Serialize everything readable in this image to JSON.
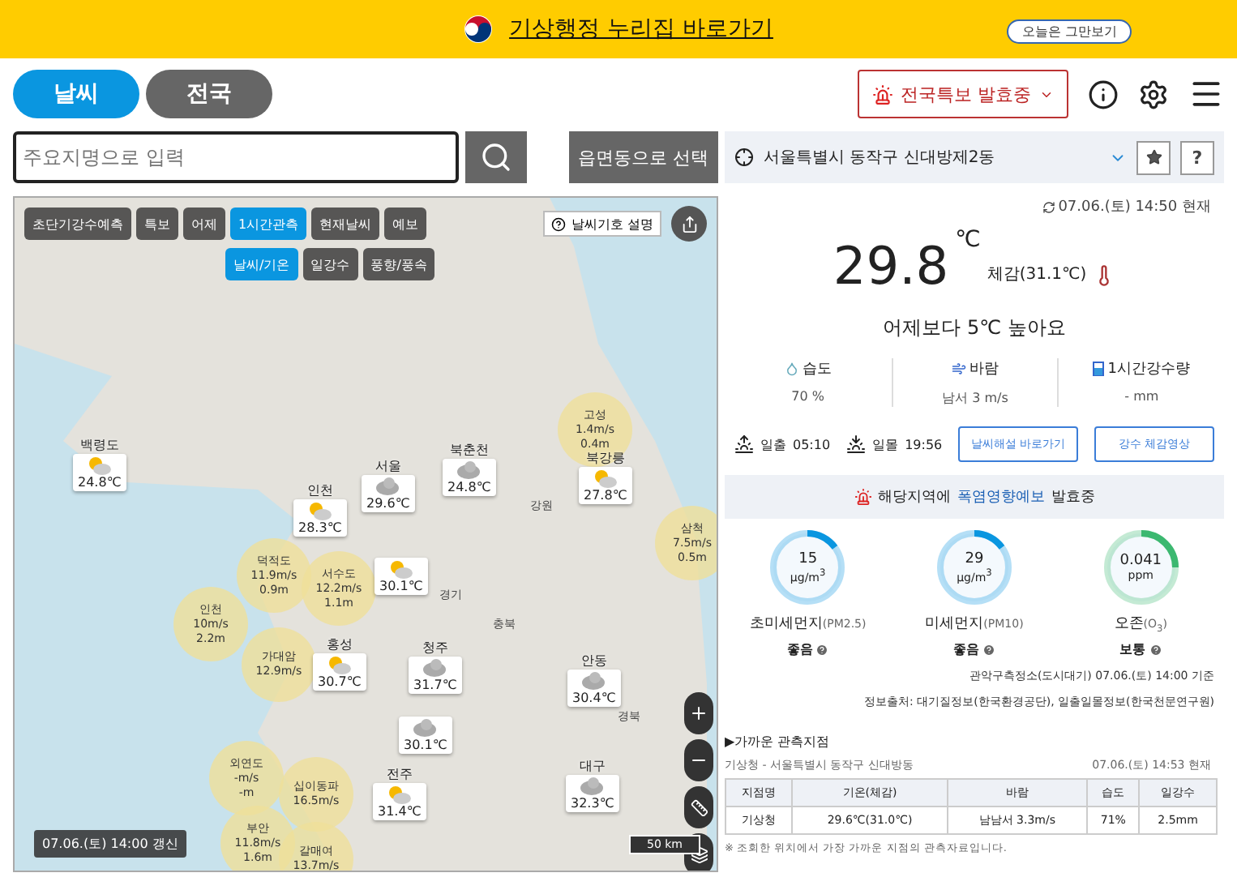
{
  "banner": {
    "link": "기상행정 누리집 바로가기",
    "dismiss": "오늘은 그만보기"
  },
  "tabs": [
    {
      "label": "날씨",
      "selected": true
    },
    {
      "label": "전국",
      "selected": false
    }
  ],
  "alert_dropdown": "전국특보 발효중",
  "search": {
    "placeholder": "주요지명으로 입력",
    "region_button": "읍면동으로 선택"
  },
  "map": {
    "tabs": [
      {
        "label": "초단기강수예측",
        "selected": false
      },
      {
        "label": "특보",
        "selected": false
      },
      {
        "label": "어제",
        "selected": false
      },
      {
        "label": "1시간관측",
        "selected": true
      },
      {
        "label": "현재날씨",
        "selected": false
      },
      {
        "label": "예보",
        "selected": false
      }
    ],
    "subtabs": [
      {
        "label": "날씨/기온",
        "selected": true
      },
      {
        "label": "일강수",
        "selected": false
      },
      {
        "label": "풍향/풍속",
        "selected": false
      }
    ],
    "legend_button": "날씨기호 설명",
    "regions": [
      "강원",
      "경기",
      "충북",
      "경북"
    ],
    "stations": [
      {
        "name": "백령도",
        "temp": "24.8℃",
        "kind": "sun_cloud"
      },
      {
        "name": "북춘천",
        "temp": "24.8℃",
        "kind": "cloud"
      },
      {
        "name": "북강릉",
        "temp": "27.8℃",
        "kind": "sun_cloud"
      },
      {
        "name": "서울",
        "temp": "29.6℃",
        "kind": "cloud"
      },
      {
        "name": "인천",
        "temp": "28.3℃",
        "kind": "sun_cloud"
      },
      {
        "temp": "30.1℃",
        "kind": "sun_cloud"
      },
      {
        "name": "홍성",
        "temp": "30.7℃",
        "kind": "sun_cloud"
      },
      {
        "name": "청주",
        "temp": "31.7℃",
        "kind": "cloud"
      },
      {
        "temp": "30.1℃",
        "kind": "cloud"
      },
      {
        "name": "안동",
        "temp": "30.4℃",
        "kind": "cloud"
      },
      {
        "name": "전주",
        "temp": "31.4℃",
        "kind": "sun_cloud"
      },
      {
        "name": "대구",
        "temp": "32.3℃",
        "kind": "cloud"
      }
    ],
    "buoys": [
      {
        "name": "고성",
        "wind": "1.4m/s",
        "wave": "0.4m"
      },
      {
        "name": "삼척",
        "wind": "7.5m/s",
        "wave": "0.5m"
      },
      {
        "name": "덕적도",
        "wind": "11.9m/s",
        "wave": "0.9m"
      },
      {
        "name": "서수도",
        "wind": "12.2m/s",
        "wave": "1.1m"
      },
      {
        "name": "인천",
        "wind": "10m/s",
        "wave": "2.2m"
      },
      {
        "name": "가대암",
        "wind": "12.9m/s"
      },
      {
        "name": "외연도",
        "wind": "-m/s",
        "wave": "-m"
      },
      {
        "name": "십이동파",
        "wind": "16.5m/s"
      },
      {
        "name": "부안",
        "wind": "11.8m/s",
        "wave": "1.6m"
      },
      {
        "name": "갈매여",
        "wind": "13.7m/s"
      }
    ],
    "updated": "07.06.(토) 14:00 갱신",
    "scale": "50 km"
  },
  "location": {
    "name": "서울특별시 동작구 신대방제2동",
    "help": "?"
  },
  "current": {
    "time": "07.06.(토) 14:50 현재",
    "temp": "29.8",
    "unit": "℃",
    "feels": "체감(31.1℃)",
    "compare": "어제보다 5℃ 높아요",
    "stats": [
      {
        "kind": "humidity",
        "label": "습도",
        "value": "70 %"
      },
      {
        "kind": "wind",
        "label": "바람",
        "value": "남서 3 m/s"
      },
      {
        "kind": "rain",
        "label": "1시간강수량",
        "value": "- mm"
      }
    ],
    "sunrise_label": "일출",
    "sunrise": "05:10",
    "sunset_label": "일몰",
    "sunset": "19:56",
    "buttons": [
      "날씨해설 바로가기",
      "강수 체감영상"
    ]
  },
  "warning": {
    "prefix": "해당지역에",
    "link": "폭염영향예보",
    "suffix": "발효중"
  },
  "air": [
    {
      "value": "15",
      "unit": "μg/m$^{3}$",
      "level": 0.15,
      "color": "#0a96e0",
      "name": "초미세먼지",
      "code": "(PM2.5)",
      "status": "좋음"
    },
    {
      "value": "29",
      "unit": "μg/m$^{3}$",
      "level": 0.15,
      "color": "#0a96e0",
      "name": "미세먼지",
      "code": "(PM10)",
      "status": "좋음"
    },
    {
      "value": "0.041",
      "unit": "ppm",
      "level": 0.25,
      "color": "#3cb870",
      "name": "오존",
      "code": "(O$_{3}$)",
      "status": "보통"
    }
  ],
  "air_station": "관악구측정소(도시대기) 07.06.(토) 14:00 기준",
  "source": "정보출처: 대기질정보(한국환경공단), 일출일몰정보(한국천문연구원)",
  "nearby": {
    "title": "▶가까운 관측지점",
    "station": "기상청 - 서울특별시 동작구 신대방동",
    "time": "07.06.(토) 14:53 현재",
    "columns": [
      "지점명",
      "기온(체감)",
      "바람",
      "습도",
      "일강수"
    ],
    "rows": [
      [
        "기상청",
        "29.6℃(31.0℃)",
        "남남서 3.3m/s",
        "71%",
        "2.5mm"
      ]
    ],
    "note": "※ 조회한 위치에서 가장 가까운 지점의 관측자료입니다."
  }
}
